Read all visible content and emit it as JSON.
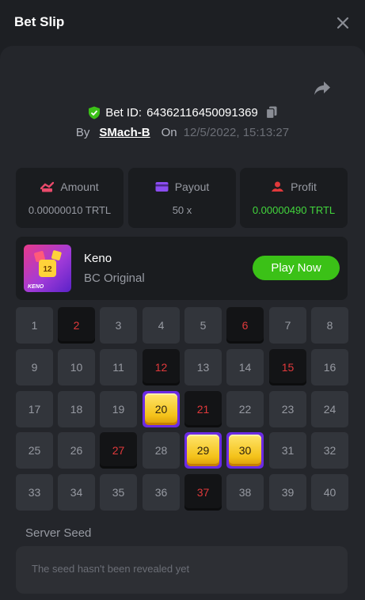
{
  "header": {
    "title": "Bet Slip"
  },
  "bet": {
    "id_label": "Bet ID:",
    "id": "64362116450091369",
    "by_label": "By",
    "user": "SMach-B",
    "on_label": "On",
    "date": "12/5/2022, 15:13:27"
  },
  "stats": {
    "amount": {
      "label": "Amount",
      "value": "0.00000010 TRTL"
    },
    "payout": {
      "label": "Payout",
      "value": "50 x"
    },
    "profit": {
      "label": "Profit",
      "value": "0.00000490 TRTL"
    }
  },
  "game": {
    "name": "Keno",
    "subtitle": "BC Original",
    "thumb_text": "KENO",
    "thumb_tile": "12",
    "play_label": "Play Now"
  },
  "grid": {
    "numbers": [
      1,
      2,
      3,
      4,
      5,
      6,
      7,
      8,
      9,
      10,
      11,
      12,
      13,
      14,
      15,
      16,
      17,
      18,
      19,
      20,
      21,
      22,
      23,
      24,
      25,
      26,
      27,
      28,
      29,
      30,
      31,
      32,
      33,
      34,
      35,
      36,
      37,
      38,
      39,
      40
    ],
    "picked": [
      2,
      6,
      12,
      15,
      21,
      27,
      37
    ],
    "hits": [
      20,
      29,
      30
    ]
  },
  "seed": {
    "label": "Server Seed",
    "value": "The seed hasn't been revealed yet"
  },
  "colors": {
    "accent_green": "#3bc117",
    "profit_green": "#42d63c",
    "picked_red": "#e0393b",
    "hit_purple": "#6b2be4"
  },
  "icons": [
    "close-icon",
    "share-icon",
    "shield-check-icon",
    "copy-icon",
    "amount-icon",
    "payout-card-icon",
    "profit-icon"
  ]
}
